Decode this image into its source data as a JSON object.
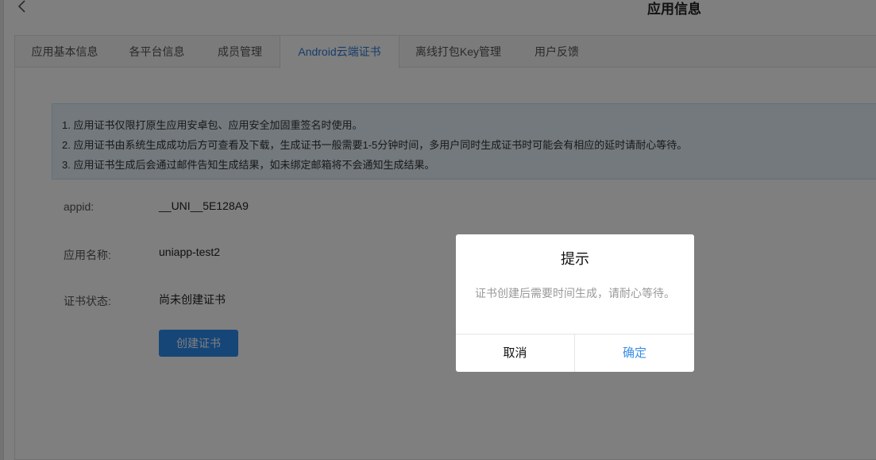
{
  "page": {
    "title": "应用信息"
  },
  "tabs": [
    {
      "label": "应用基本信息",
      "active": false
    },
    {
      "label": "各平台信息",
      "active": false
    },
    {
      "label": "成员管理",
      "active": false
    },
    {
      "label": "Android云端证书",
      "active": true
    },
    {
      "label": "离线打包Key管理",
      "active": false
    },
    {
      "label": "用户反馈",
      "active": false
    }
  ],
  "notice": {
    "lines": [
      "1. 应用证书仅限打原生应用安卓包、应用安全加固重签名时使用。",
      "2. 应用证书由系统生成成功后方可查看及下载，生成证书一般需要1-5分钟时间，多用户同时生成证书时可能会有相应的延时请耐心等待。",
      "3. 应用证书生成后会通过邮件告知生成结果，如未绑定邮箱将不会通知生成结果。"
    ]
  },
  "fields": {
    "appid": {
      "label": "appid:",
      "value": "__UNI__5E128A9"
    },
    "app_name": {
      "label": "应用名称:",
      "value": "uniapp-test2"
    },
    "cert_status": {
      "label": "证书状态:",
      "value": "尚未创建证书"
    }
  },
  "create_button": {
    "label": "创建证书"
  },
  "dialog": {
    "title": "提示",
    "message": "证书创建后需要时间生成，请耐心等待。",
    "cancel_label": "取消",
    "confirm_label": "确定"
  },
  "colors": {
    "accent": "#2d8cf0",
    "active_tab_text": "#2a7bd4",
    "notice_bg": "#e6f3fb",
    "overlay": "rgba(0,0,0,0.5)"
  },
  "icons": {
    "back": "chevron-left-icon"
  }
}
